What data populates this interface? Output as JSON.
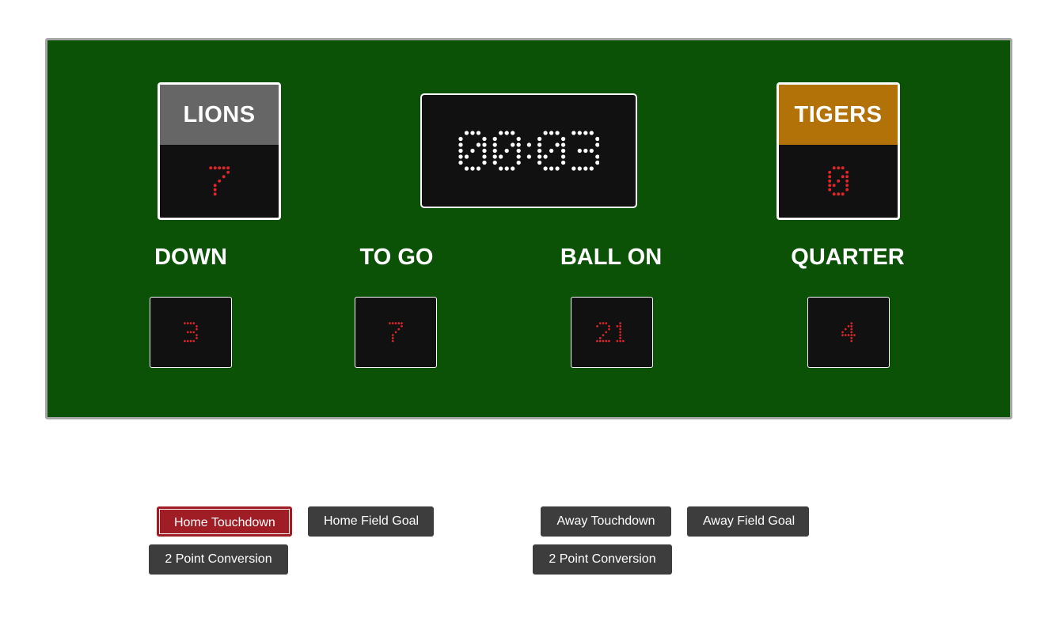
{
  "home": {
    "name": "LIONS",
    "score": "7",
    "color": "#666666"
  },
  "away": {
    "name": "TIGERS",
    "score": "0",
    "color": "#b27208"
  },
  "clock": {
    "value": "00:03"
  },
  "stats": {
    "down": {
      "label": "DOWN",
      "value": "3"
    },
    "to_go": {
      "label": "TO GO",
      "value": "7"
    },
    "ball_on": {
      "label": "BALL ON",
      "value": "21"
    },
    "quarter": {
      "label": "QUARTER",
      "value": "4"
    }
  },
  "buttons": {
    "home_touchdown": "Home Touchdown",
    "home_field_goal": "Home Field Goal",
    "home_two_point": "2 Point Conversion",
    "away_touchdown": "Away Touchdown",
    "away_field_goal": "Away Field Goal",
    "away_two_point": "2 Point Conversion"
  },
  "colors": {
    "board": "#0b5206",
    "led_red": "#e0262b",
    "led_white": "#ffffff",
    "active_button": "#a11d25",
    "button": "#3d3d3d"
  }
}
